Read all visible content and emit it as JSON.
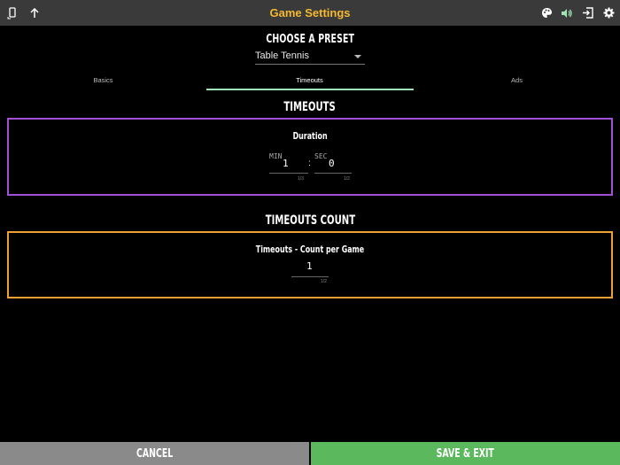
{
  "header": {
    "title": "Game Settings",
    "left_icons": [
      "phone-rotate-icon",
      "arrow-up-icon"
    ],
    "right_icons": [
      "palette-icon",
      "volume-icon",
      "exit-icon",
      "gear-icon"
    ],
    "title_color": "#f5b82e"
  },
  "preset": {
    "heading": "CHOOSE A PRESET",
    "selected": "Table Tennis"
  },
  "tabs": [
    {
      "label": "Basics",
      "active": false
    },
    {
      "label": "Timeouts",
      "active": true
    },
    {
      "label": "Ads",
      "active": false
    }
  ],
  "timeouts": {
    "heading": "TIMEOUTS",
    "duration": {
      "label": "Duration",
      "minutes": {
        "label": "MIN",
        "value": "1",
        "counter": "1/3"
      },
      "separator": ":",
      "seconds": {
        "label": "SEC",
        "value": "0",
        "counter": "1/2"
      },
      "border_color": "#a14fd3"
    }
  },
  "timeouts_count": {
    "heading": "TIMEOUTS COUNT",
    "count": {
      "label": "Timeouts - Count per Game",
      "value": "1",
      "counter": "1/2",
      "border_color": "#f0a030"
    }
  },
  "footer": {
    "cancel_label": "CANCEL",
    "save_label": "SAVE & EXIT",
    "cancel_color": "#8a8a8a",
    "save_color": "#5cb85c"
  }
}
